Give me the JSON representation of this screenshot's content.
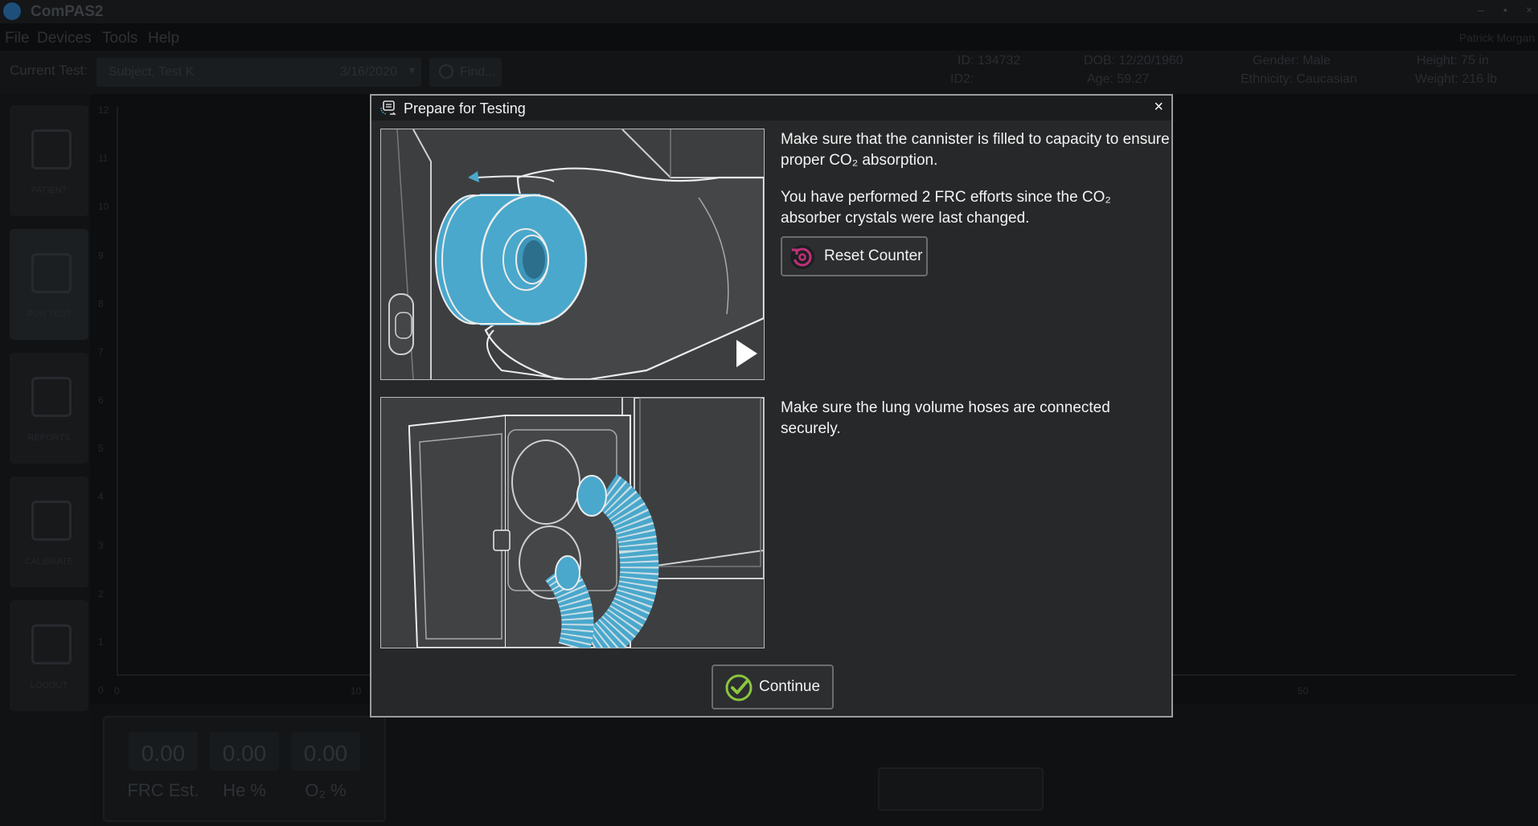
{
  "app": {
    "title": "ComPAS2",
    "menu": [
      "File",
      "Devices",
      "Tools",
      "Help"
    ],
    "user": "Patrick Morgan",
    "window_controls": [
      "–",
      "▪",
      "×"
    ]
  },
  "test_bar": {
    "label": "Current Test:",
    "selected": "Subject, Test K",
    "date": "3/16/2020",
    "find_label": "Find..."
  },
  "patient": {
    "id": "ID: 134732",
    "id2": "ID2:",
    "dob": "DOB: 12/20/1960",
    "age": "Age: 59.27",
    "gender": "Gender: Male",
    "ethnicity": "Ethnicity: Caucasian",
    "height": "Height: 75 in",
    "weight": "Weight: 216 lb"
  },
  "nav": [
    {
      "label": "PATIENT",
      "icon": "patients-icon"
    },
    {
      "label": "RUN TEST",
      "icon": "run-test-icon"
    },
    {
      "label": "REPORTS",
      "icon": "reports-icon"
    },
    {
      "label": "CALIBRATE",
      "icon": "calibrate-icon"
    },
    {
      "label": "LOGOUT",
      "icon": "logout-icon"
    }
  ],
  "chart": {
    "y_ticks": [
      "12",
      "11",
      "10",
      "9",
      "8",
      "7",
      "6",
      "5",
      "4",
      "3",
      "2",
      "1",
      "0"
    ],
    "x_ticks": [
      "0",
      "10",
      "50"
    ]
  },
  "readouts": [
    {
      "value": "0.00",
      "label": "FRC Est."
    },
    {
      "value": "0.00",
      "label": "He %"
    },
    {
      "value": "0.00",
      "label": "O₂ %"
    }
  ],
  "dialog": {
    "title": "Prepare for Testing",
    "close": "×",
    "msg1": "Make sure that the cannister is filled to capacity to ensure proper CO₂ absorption.",
    "msg2": "You have performed 2 FRC efforts since the CO₂ absorber crystals were last changed.",
    "reset_label": "Reset Counter",
    "msg3": "Make sure the lung volume hoses are connected securely.",
    "continue_label": "Continue",
    "colors": {
      "accent_blue": "#4aa8cc",
      "reset_magenta": "#c0307a",
      "continue_green": "#8cc63f"
    }
  }
}
